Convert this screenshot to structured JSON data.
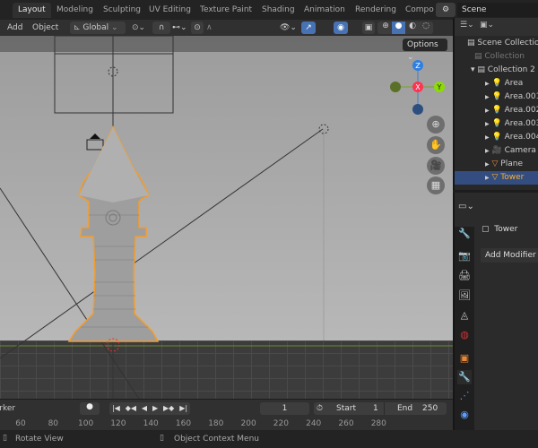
{
  "workspace_tabs": [
    "Layout",
    "Modeling",
    "Sculpting",
    "UV Editing",
    "Texture Paint",
    "Shading",
    "Animation",
    "Rendering",
    "Compo"
  ],
  "scene": "Scene",
  "header": {
    "add": "Add",
    "object": "Object",
    "orientation": "Global",
    "options": "Options"
  },
  "gizmo": {
    "z": "Z",
    "x": "X",
    "y": "Y",
    "colors": {
      "x": "#ff3352",
      "y": "#8bdc00",
      "z": "#2890ff"
    }
  },
  "outliner": {
    "items": [
      {
        "label": "Scene Collection",
        "icon": "collection-icon"
      },
      {
        "label": "Collection",
        "icon": "collection-icon"
      },
      {
        "label": "Collection 2",
        "icon": "collection-icon"
      },
      {
        "label": "Area",
        "icon": "light-icon"
      },
      {
        "label": "Area.001",
        "icon": "light-icon"
      },
      {
        "label": "Area.002",
        "icon": "light-icon"
      },
      {
        "label": "Area.003",
        "icon": "light-icon"
      },
      {
        "label": "Area.004",
        "icon": "light-icon"
      },
      {
        "label": "Camera",
        "icon": "camera-icon"
      },
      {
        "label": "Plane",
        "icon": "mesh-icon"
      },
      {
        "label": "Tower",
        "icon": "mesh-icon",
        "selected": true
      }
    ]
  },
  "properties": {
    "object_name": "Tower",
    "add_modifier": "Add Modifier"
  },
  "timeline": {
    "marker": "Marker",
    "current_frame": "1",
    "start_label": "Start",
    "start": "1",
    "end_label": "End",
    "end": "250",
    "ticks": [
      "60",
      "80",
      "100",
      "120",
      "140",
      "160",
      "180",
      "200",
      "220",
      "240",
      "260",
      "280"
    ]
  },
  "status": {
    "left": "Rotate View",
    "middle": "Object Context Menu"
  },
  "accent": "#4772b3",
  "selection": "#ffa030"
}
